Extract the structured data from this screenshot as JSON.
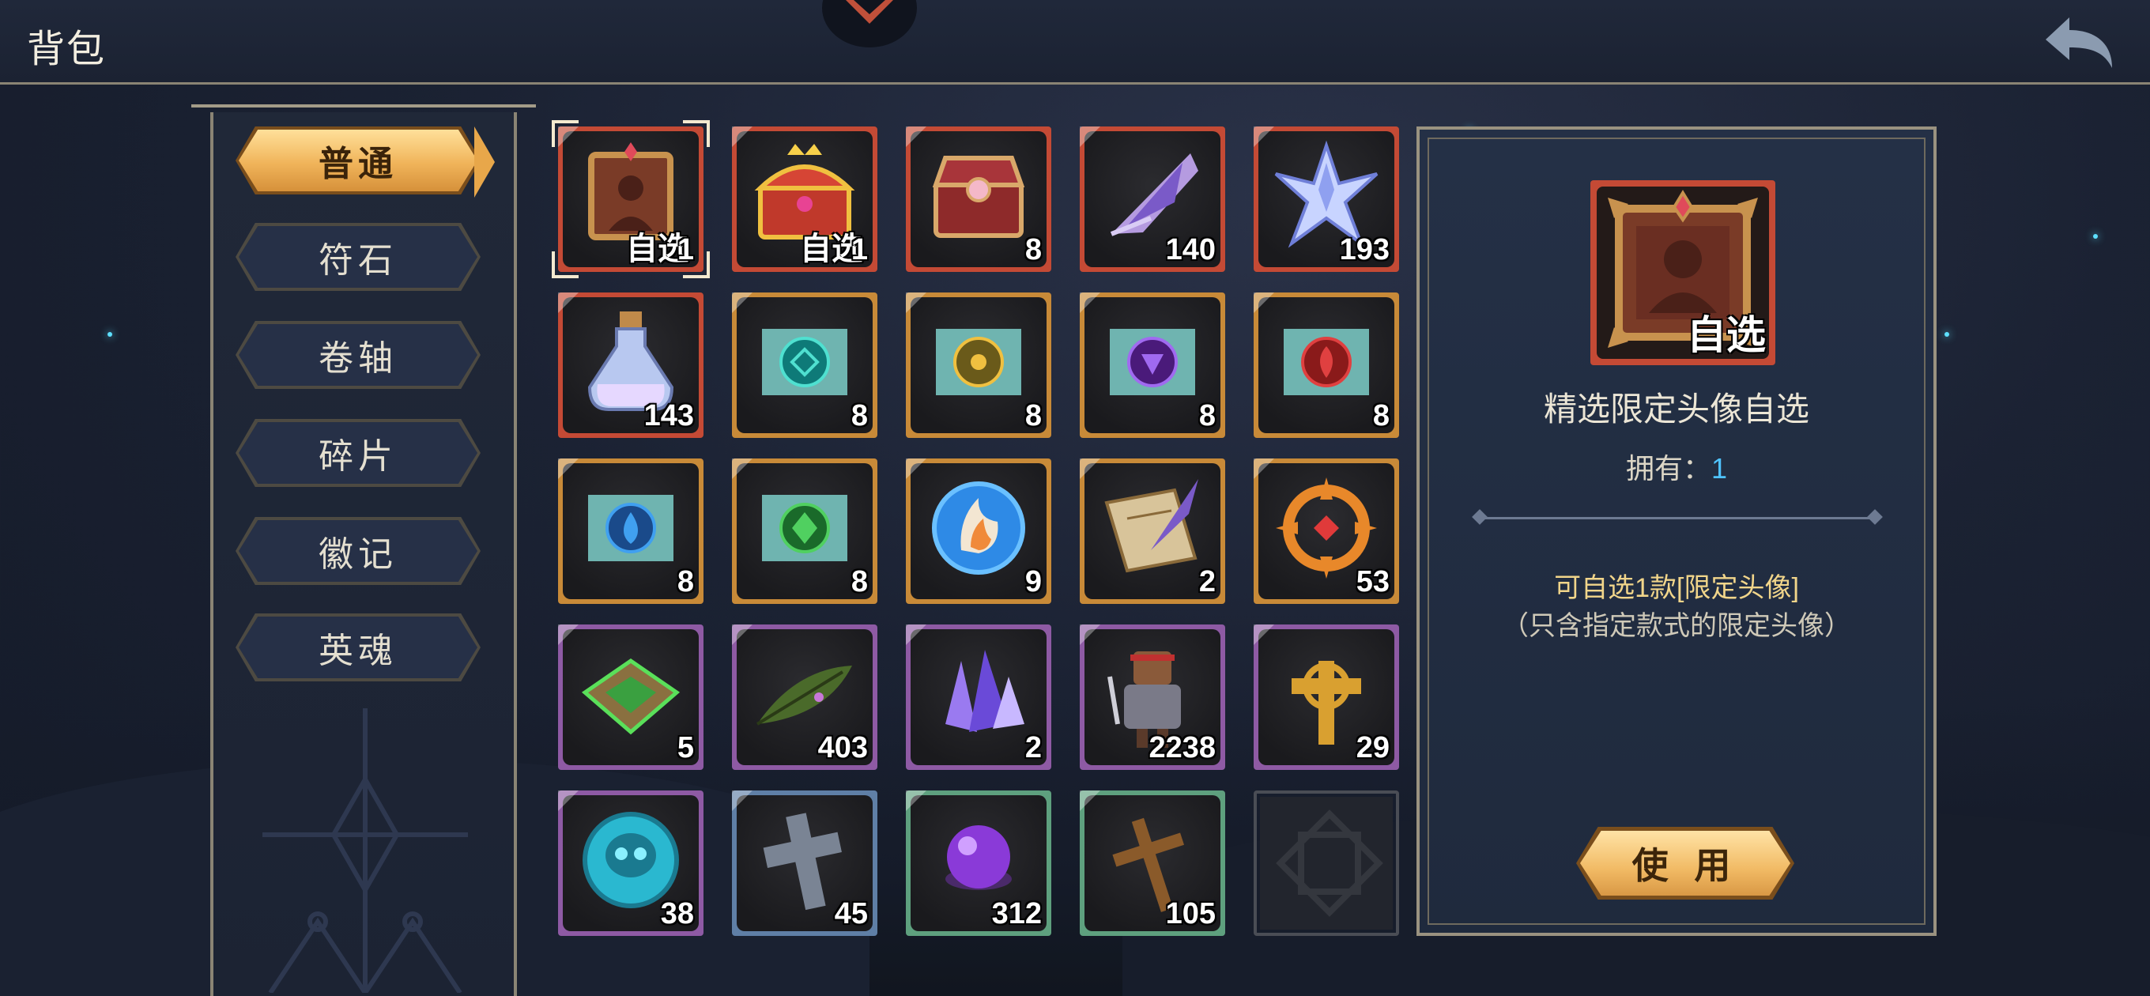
{
  "header": {
    "title": "背包"
  },
  "sidebar": {
    "tabs": [
      {
        "label": "普通",
        "active": true
      },
      {
        "label": "符石",
        "active": false
      },
      {
        "label": "卷轴",
        "active": false
      },
      {
        "label": "碎片",
        "active": false
      },
      {
        "label": "徽记",
        "active": false
      },
      {
        "label": "英魂",
        "active": false
      }
    ]
  },
  "inventory": {
    "items": [
      {
        "icon": "avatar-frame-icon",
        "rarity": "red",
        "tag": "自选",
        "count": "1",
        "selected": true
      },
      {
        "icon": "golden-chest-icon",
        "rarity": "red",
        "tag": "自选",
        "count": "1"
      },
      {
        "icon": "red-chest-icon",
        "rarity": "red",
        "count": "8"
      },
      {
        "icon": "purple-crystal-wing-icon",
        "rarity": "red",
        "count": "140"
      },
      {
        "icon": "star-crystal-icon",
        "rarity": "red",
        "count": "193"
      },
      {
        "icon": "potion-bottle-icon",
        "rarity": "red",
        "count": "143"
      },
      {
        "icon": "teal-rune-scroll-icon",
        "rarity": "gold",
        "count": "8"
      },
      {
        "icon": "sun-rune-scroll-icon",
        "rarity": "gold",
        "count": "8"
      },
      {
        "icon": "purple-rune-scroll-icon",
        "rarity": "gold",
        "count": "8"
      },
      {
        "icon": "fire-rune-scroll-icon",
        "rarity": "gold",
        "count": "8"
      },
      {
        "icon": "water-rune-scroll-icon",
        "rarity": "gold",
        "count": "8"
      },
      {
        "icon": "leaf-rune-scroll-icon",
        "rarity": "gold",
        "count": "8"
      },
      {
        "icon": "flame-badge-icon",
        "rarity": "gold",
        "count": "9"
      },
      {
        "icon": "quill-scroll-icon",
        "rarity": "gold",
        "count": "2"
      },
      {
        "icon": "orange-wheel-icon",
        "rarity": "gold",
        "count": "53"
      },
      {
        "icon": "green-relic-icon",
        "rarity": "purple",
        "count": "5"
      },
      {
        "icon": "green-leaf-icon",
        "rarity": "purple",
        "count": "403"
      },
      {
        "icon": "purple-crystal-icon",
        "rarity": "purple",
        "count": "2"
      },
      {
        "icon": "warrior-figure-icon",
        "rarity": "purple",
        "count": "2238"
      },
      {
        "icon": "golden-cross-icon",
        "rarity": "purple",
        "count": "29"
      },
      {
        "icon": "skull-coin-icon",
        "rarity": "purple",
        "count": "38"
      },
      {
        "icon": "stone-cross-icon",
        "rarity": "blue",
        "count": "45"
      },
      {
        "icon": "purple-orb-icon",
        "rarity": "green",
        "count": "312"
      },
      {
        "icon": "wooden-cross-icon",
        "rarity": "green",
        "count": "105"
      },
      {
        "icon": "empty-slot-icon",
        "rarity": "empty",
        "count": ""
      }
    ]
  },
  "detail": {
    "tag": "自选",
    "name": "精选限定头像自选",
    "own_label": "拥有：",
    "own_count": "1",
    "desc_line1": "可自选1款[限定头像]",
    "desc_line2": "（只含指定款式的限定头像）",
    "use_label": "使 用"
  },
  "colors": {
    "red": "#c44a35",
    "gold": "#c88a38",
    "purple": "#8e5aa4",
    "blue": "#5f7fa6",
    "green": "#5ea07e",
    "accent_blue": "#4fc3ff"
  }
}
